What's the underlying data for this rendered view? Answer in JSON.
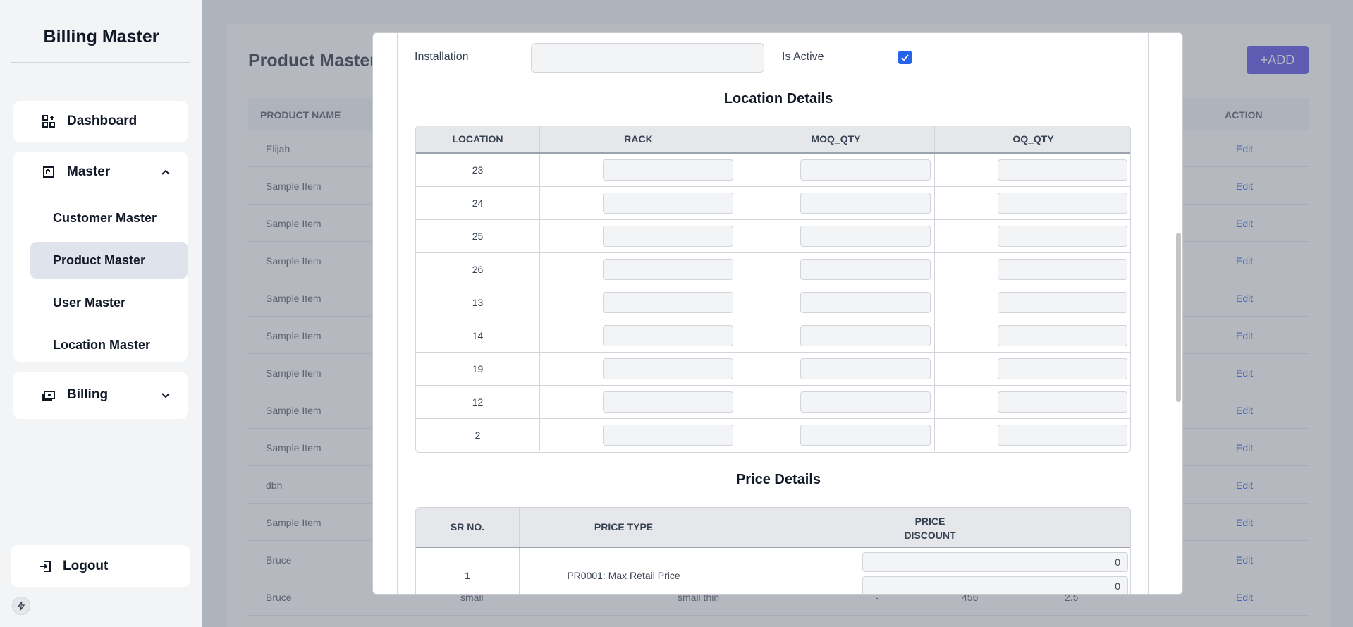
{
  "sidebar": {
    "brand": "Billing Master",
    "dashboard": "Dashboard",
    "master": "Master",
    "master_items": [
      "Customer Master",
      "Product Master",
      "User Master",
      "Location Master"
    ],
    "billing": "Billing",
    "logout": "Logout"
  },
  "page": {
    "title": "Product Master",
    "add_button": "+ADD",
    "columns": {
      "product_name": "PRODUCT NAME",
      "action": "ACTION"
    },
    "rows": [
      {
        "name": "Elijah",
        "edit": "Edit"
      },
      {
        "name": "Sample Item",
        "edit": "Edit"
      },
      {
        "name": "Sample Item",
        "edit": "Edit"
      },
      {
        "name": "Sample Item",
        "edit": "Edit"
      },
      {
        "name": "Sample Item",
        "edit": "Edit"
      },
      {
        "name": "Sample Item",
        "edit": "Edit"
      },
      {
        "name": "Sample Item",
        "edit": "Edit"
      },
      {
        "name": "Sample Item",
        "edit": "Edit"
      },
      {
        "name": "Sample Item",
        "edit": "Edit"
      },
      {
        "name": "dbh",
        "edit": "Edit"
      },
      {
        "name": "Sample Item",
        "edit": "Edit"
      },
      {
        "name": "Bruce",
        "edit": "Edit"
      },
      {
        "name": "Bruce",
        "c3": "small",
        "c4": "small thin",
        "c5": "-",
        "c6": "456",
        "c7": "2.5",
        "edit": "Edit"
      }
    ]
  },
  "modal": {
    "installation_label": "Installation",
    "installation_value": "",
    "is_active_label": "Is Active",
    "is_active": true,
    "location_title": "Location Details",
    "location_columns": [
      "LOCATION",
      "RACK",
      "MOQ_QTY",
      "OQ_QTY"
    ],
    "locations": [
      "23",
      "24",
      "25",
      "26",
      "13",
      "14",
      "19",
      "12",
      "2"
    ],
    "price_title": "Price Details",
    "price_columns": {
      "sr": "SR NO.",
      "type": "PRICE TYPE",
      "price": "PRICE",
      "discount": "DISCOUNT"
    },
    "price_rows": [
      {
        "sr": "1",
        "type": "PR0001: Max Retail Price",
        "price": "0",
        "discount": "0"
      }
    ]
  },
  "colors": {
    "accent": "#4f46e5",
    "link": "#2563eb",
    "checkbox": "#2563eb"
  }
}
